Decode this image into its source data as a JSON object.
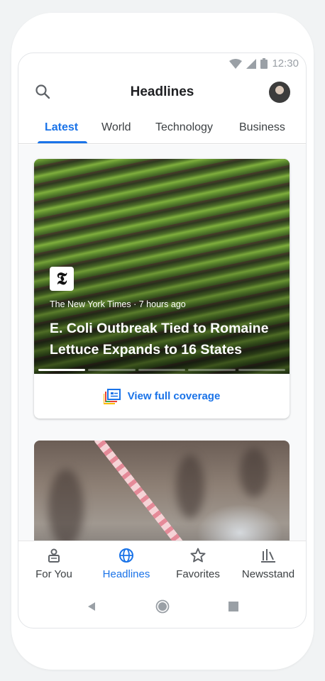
{
  "status_bar": {
    "time": "12:30",
    "icons": [
      "wifi-icon",
      "signal-icon",
      "battery-icon"
    ]
  },
  "header": {
    "title": "Headlines",
    "search_icon": "search-icon",
    "avatar": "user-avatar"
  },
  "tabs": [
    {
      "label": "Latest",
      "active": true
    },
    {
      "label": "World",
      "active": false
    },
    {
      "label": "Technology",
      "active": false
    },
    {
      "label": "Business",
      "active": false
    }
  ],
  "story": {
    "publisher_logo": "𝕿",
    "publisher": "The New York Times",
    "age": "7 hours ago",
    "meta": "The New York Times · 7 hours ago",
    "headline": "E. Coli Outbreak Tied to Romaine Lettuce Expands to 16 States",
    "progress_segments": 5,
    "progress_current": 1,
    "coverage_label": "View full coverage",
    "coverage_icon": "full-coverage-icon"
  },
  "bottom_nav": [
    {
      "label": "For You",
      "icon": "for-you-icon",
      "active": false
    },
    {
      "label": "Headlines",
      "icon": "globe-icon",
      "active": true
    },
    {
      "label": "Favorites",
      "icon": "star-icon",
      "active": false
    },
    {
      "label": "Newsstand",
      "icon": "newsstand-icon",
      "active": false
    }
  ],
  "colors": {
    "accent": "#1a73e8",
    "text_primary": "#202124",
    "text_secondary": "#3c4043",
    "status_icons": "#9aa0a6"
  }
}
